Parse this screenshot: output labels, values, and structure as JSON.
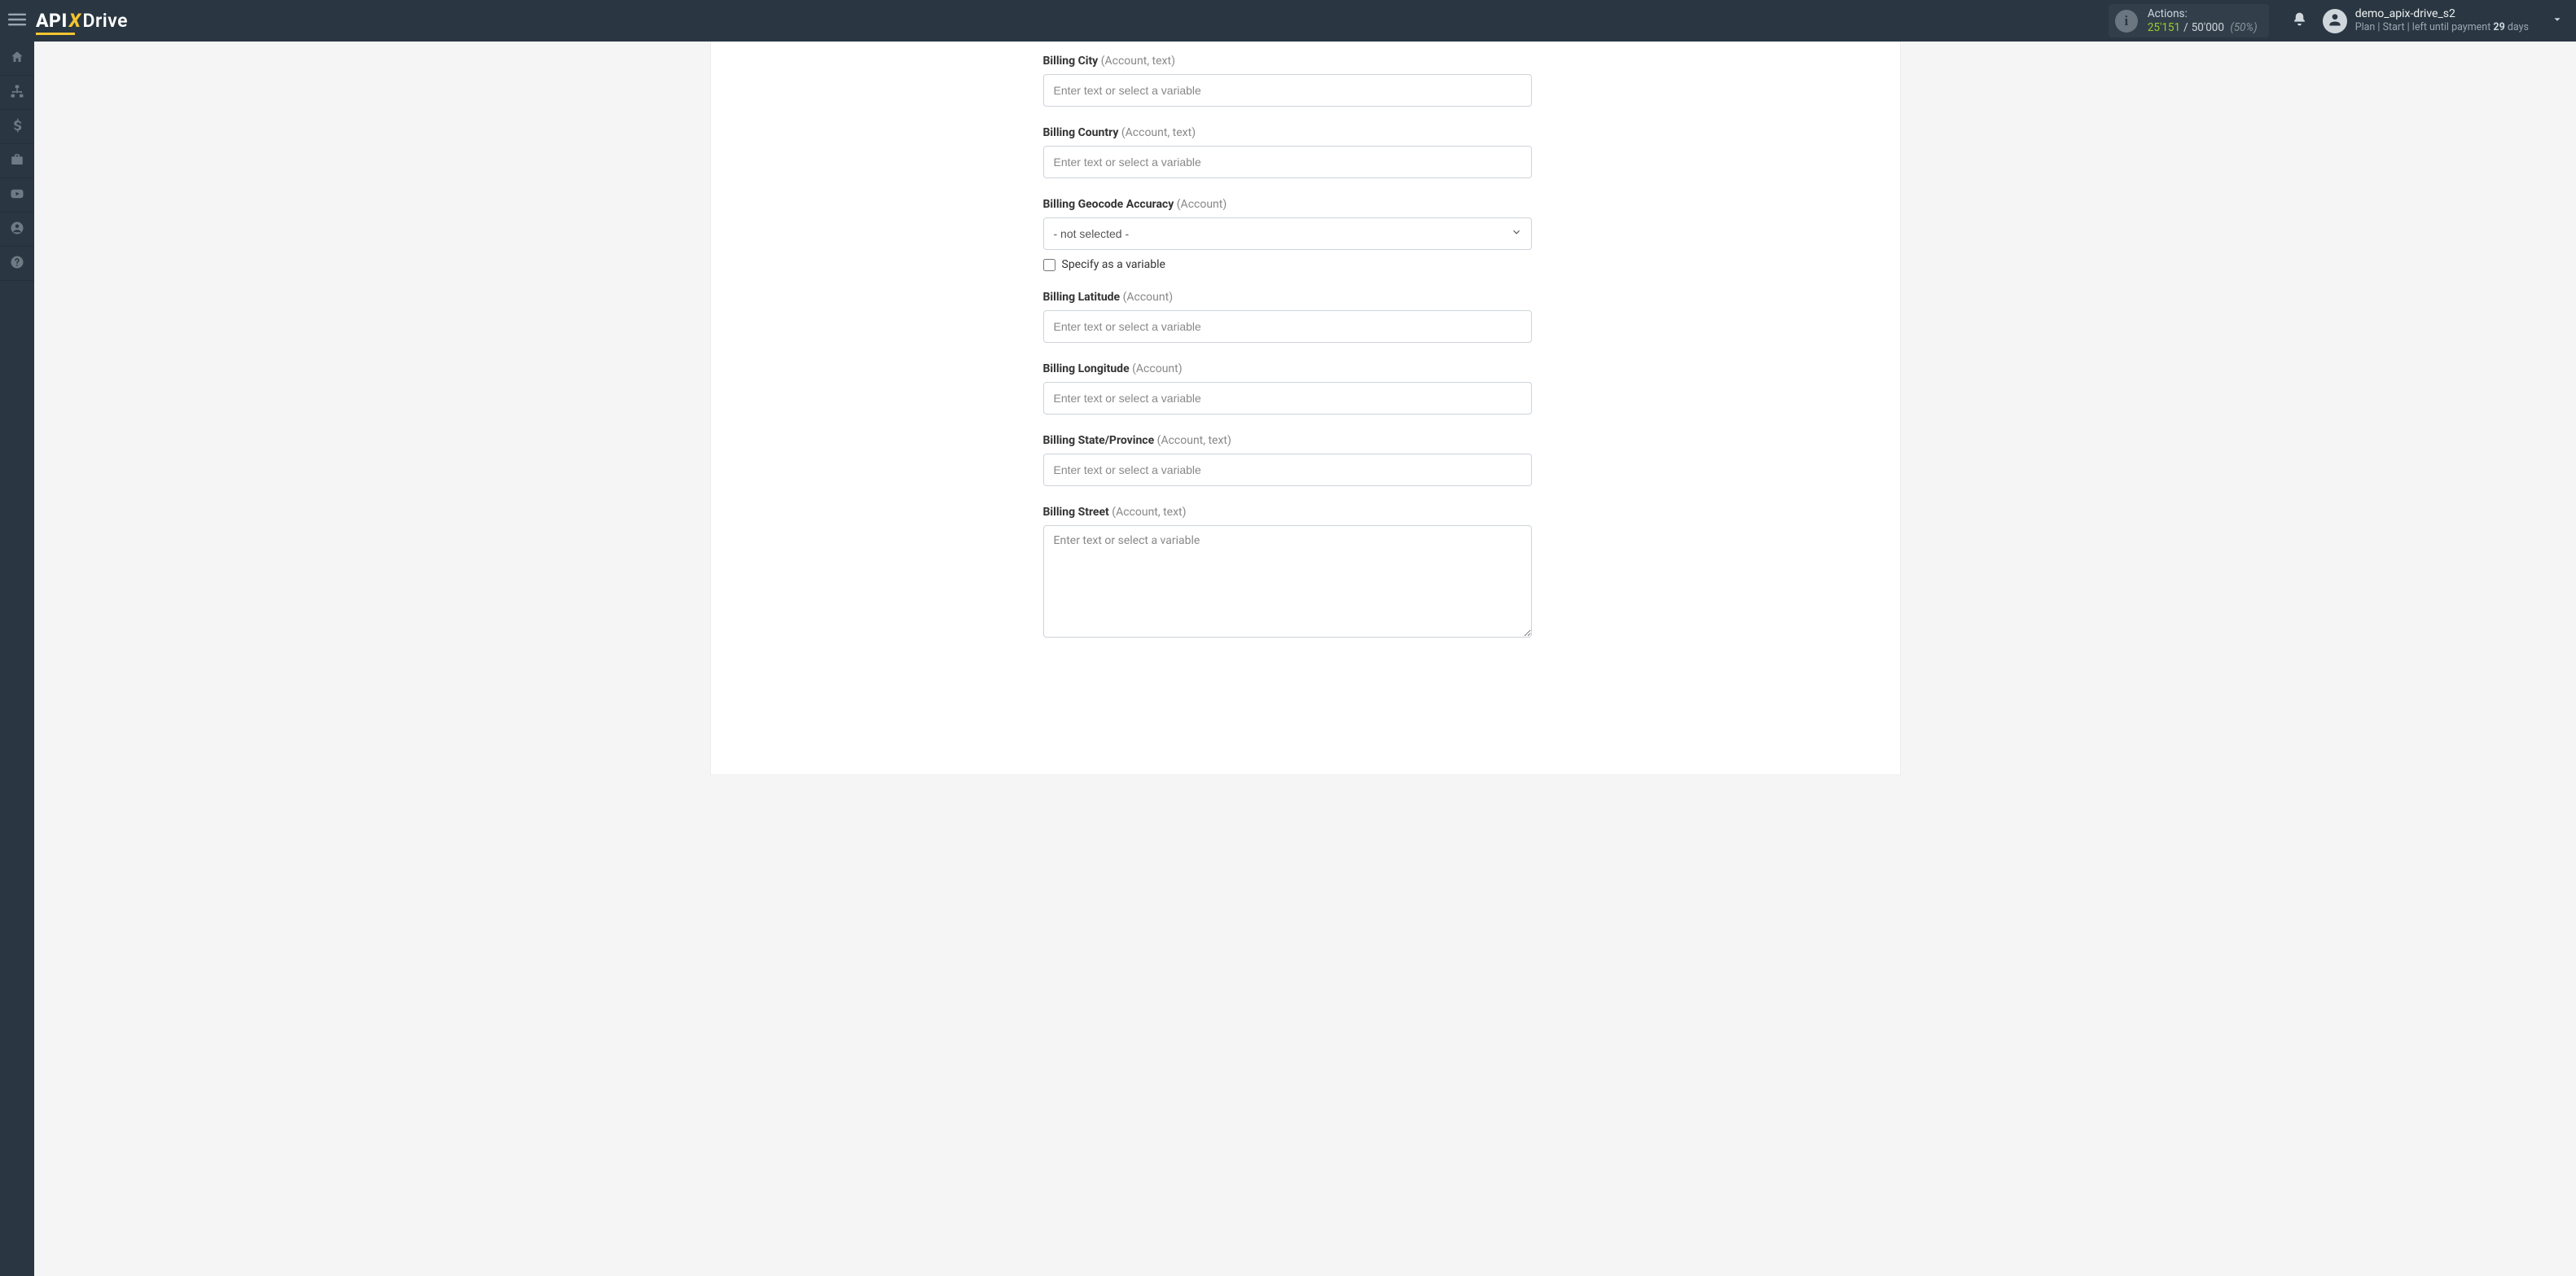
{
  "brand": {
    "api": "API",
    "x": "X",
    "drive": "Drive"
  },
  "header": {
    "actions_label": "Actions:",
    "actions_used": "25'151",
    "actions_total": "50'000",
    "actions_pct": "(50%)",
    "user_name": "demo_apix-drive_s2",
    "plan_prefix": "Plan |",
    "plan_name": "Start",
    "plan_mid": "| left until payment",
    "plan_days": "29",
    "plan_suffix": "days"
  },
  "form": {
    "placeholder_text": "Enter text or select a variable",
    "select_placeholder": "- not selected -",
    "specify_as_variable": "Specify as a variable",
    "fields": {
      "billing_city": {
        "label": "Billing City",
        "meta": "(Account, text)"
      },
      "billing_country": {
        "label": "Billing Country",
        "meta": "(Account, text)"
      },
      "billing_geo": {
        "label": "Billing Geocode Accuracy",
        "meta": "(Account)"
      },
      "billing_lat": {
        "label": "Billing Latitude",
        "meta": "(Account)"
      },
      "billing_lng": {
        "label": "Billing Longitude",
        "meta": "(Account)"
      },
      "billing_state": {
        "label": "Billing State/Province",
        "meta": "(Account, text)"
      },
      "billing_street": {
        "label": "Billing Street",
        "meta": "(Account, text)"
      }
    }
  }
}
